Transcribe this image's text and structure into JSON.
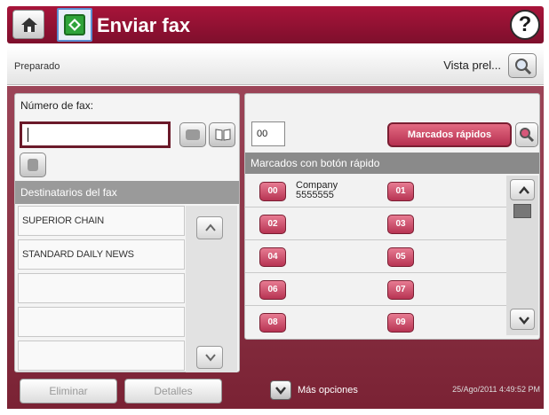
{
  "header": {
    "title": "Enviar fax",
    "help_glyph": "?"
  },
  "status": {
    "text": "Preparado",
    "preview_label": "Vista prel..."
  },
  "fax": {
    "label": "Número de fax:",
    "value": ""
  },
  "recipients": {
    "header": "Destinatarios del fax",
    "items": [
      "SUPERIOR CHAIN",
      "STANDARD DAILY NEWS",
      "",
      "",
      ""
    ]
  },
  "buttons": {
    "delete": "Eliminar",
    "details": "Detalles"
  },
  "speed_dial": {
    "code_value": "00",
    "button_label": "Marcados rápidos",
    "header": "Marcados con botón rápido",
    "rows": [
      {
        "left_code": "00",
        "left_name": "Company",
        "left_number": "5555555",
        "right_code": "01"
      },
      {
        "left_code": "02",
        "left_name": "",
        "left_number": "",
        "right_code": "03"
      },
      {
        "left_code": "04",
        "left_name": "",
        "left_number": "",
        "right_code": "05"
      },
      {
        "left_code": "06",
        "left_name": "",
        "left_number": "",
        "right_code": "07"
      },
      {
        "left_code": "08",
        "left_name": "",
        "left_number": "",
        "right_code": "09"
      }
    ]
  },
  "footer": {
    "more_options": "Más opciones",
    "timestamp": "25/Ago/2011 4:49:52 PM"
  },
  "colors": {
    "accent": "#8e1234",
    "speed_button": "#c0415e",
    "panel_bg": "#8a3446"
  }
}
